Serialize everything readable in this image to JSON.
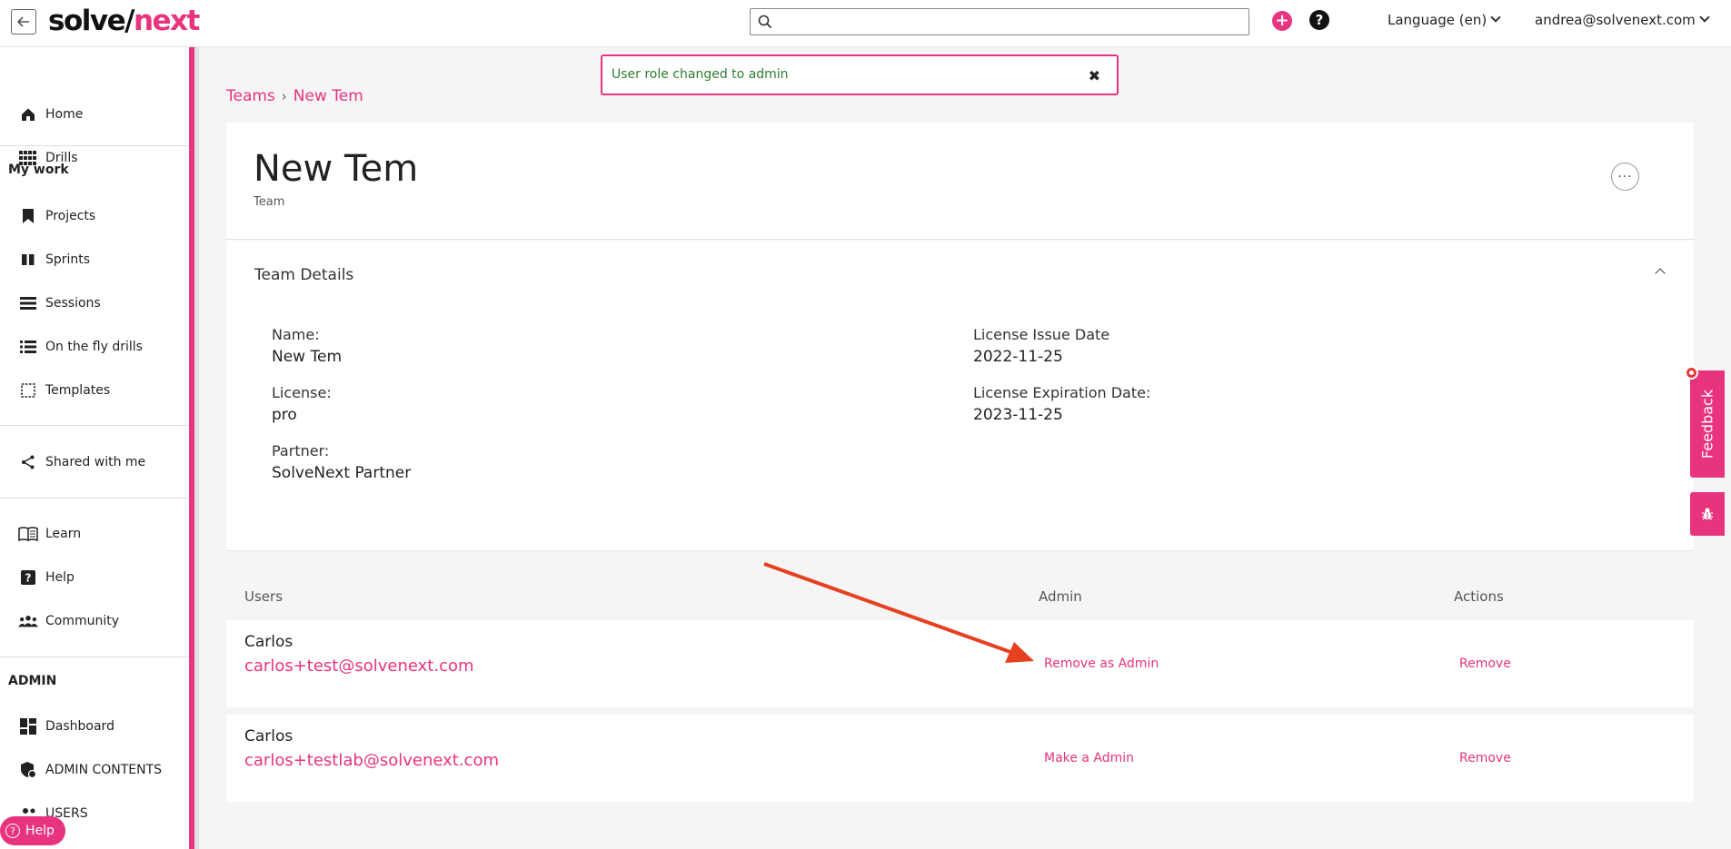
{
  "header": {
    "logo_part1": "solve/",
    "logo_part2": "next",
    "search_placeholder": "",
    "language_label": "Language (en)",
    "user_email": "andrea@solvenext.com"
  },
  "sidebar": {
    "items_top": [
      {
        "label": "Home",
        "icon": "home-icon"
      },
      {
        "label": "Drills",
        "icon": "grid-icon"
      }
    ],
    "my_work_title": "My work",
    "my_work_items": [
      {
        "label": "Projects",
        "icon": "bookmark-icon"
      },
      {
        "label": "Sprints",
        "icon": "columns-icon"
      },
      {
        "label": "Sessions",
        "icon": "list-icon"
      },
      {
        "label": "On the fly drills",
        "icon": "checklist-icon"
      },
      {
        "label": "Templates",
        "icon": "template-icon"
      }
    ],
    "shared_label": "Shared with me",
    "support_items": [
      {
        "label": "Learn",
        "icon": "book-icon"
      },
      {
        "label": "Help",
        "icon": "question-icon"
      },
      {
        "label": "Community",
        "icon": "people-icon"
      }
    ],
    "admin_title": "ADMIN",
    "admin_items": [
      {
        "label": "Dashboard",
        "icon": "dashboard-icon"
      },
      {
        "label": "ADMIN CONTENTS",
        "icon": "shield-icon"
      },
      {
        "label": "USERS",
        "icon": "users-icon"
      }
    ],
    "help_pill": "Help"
  },
  "toast": {
    "message": "User role changed to admin",
    "close": "✖"
  },
  "breadcrumb": {
    "root": "Teams",
    "separator": "›",
    "current": "New Tem"
  },
  "team": {
    "name": "New Tem",
    "type": "Team",
    "more": "···"
  },
  "details": {
    "title": "Team Details",
    "name_label": "Name:",
    "name_value": "New Tem",
    "license_label": "License:",
    "license_value": "pro",
    "partner_label": "Partner:",
    "partner_value": "SolveNext Partner",
    "issue_label": "License Issue Date",
    "issue_value": "2022-11-25",
    "expiration_label": "License Expiration Date:",
    "expiration_value": "2023-11-25"
  },
  "users_table": {
    "columns": [
      "Users",
      "Admin",
      "Actions"
    ],
    "rows": [
      {
        "name": "Carlos",
        "email": "carlos+test@solvenext.com",
        "admin_action": "Remove as Admin",
        "action": "Remove"
      },
      {
        "name": "Carlos",
        "email": "carlos+testlab@solvenext.com",
        "admin_action": "Make a Admin",
        "action": "Remove"
      }
    ]
  },
  "widgets": {
    "feedback": "Feedback"
  },
  "colors": {
    "accent": "#e8337e",
    "success_text": "#2e7d32",
    "annotation_arrow": "#e5401f"
  }
}
